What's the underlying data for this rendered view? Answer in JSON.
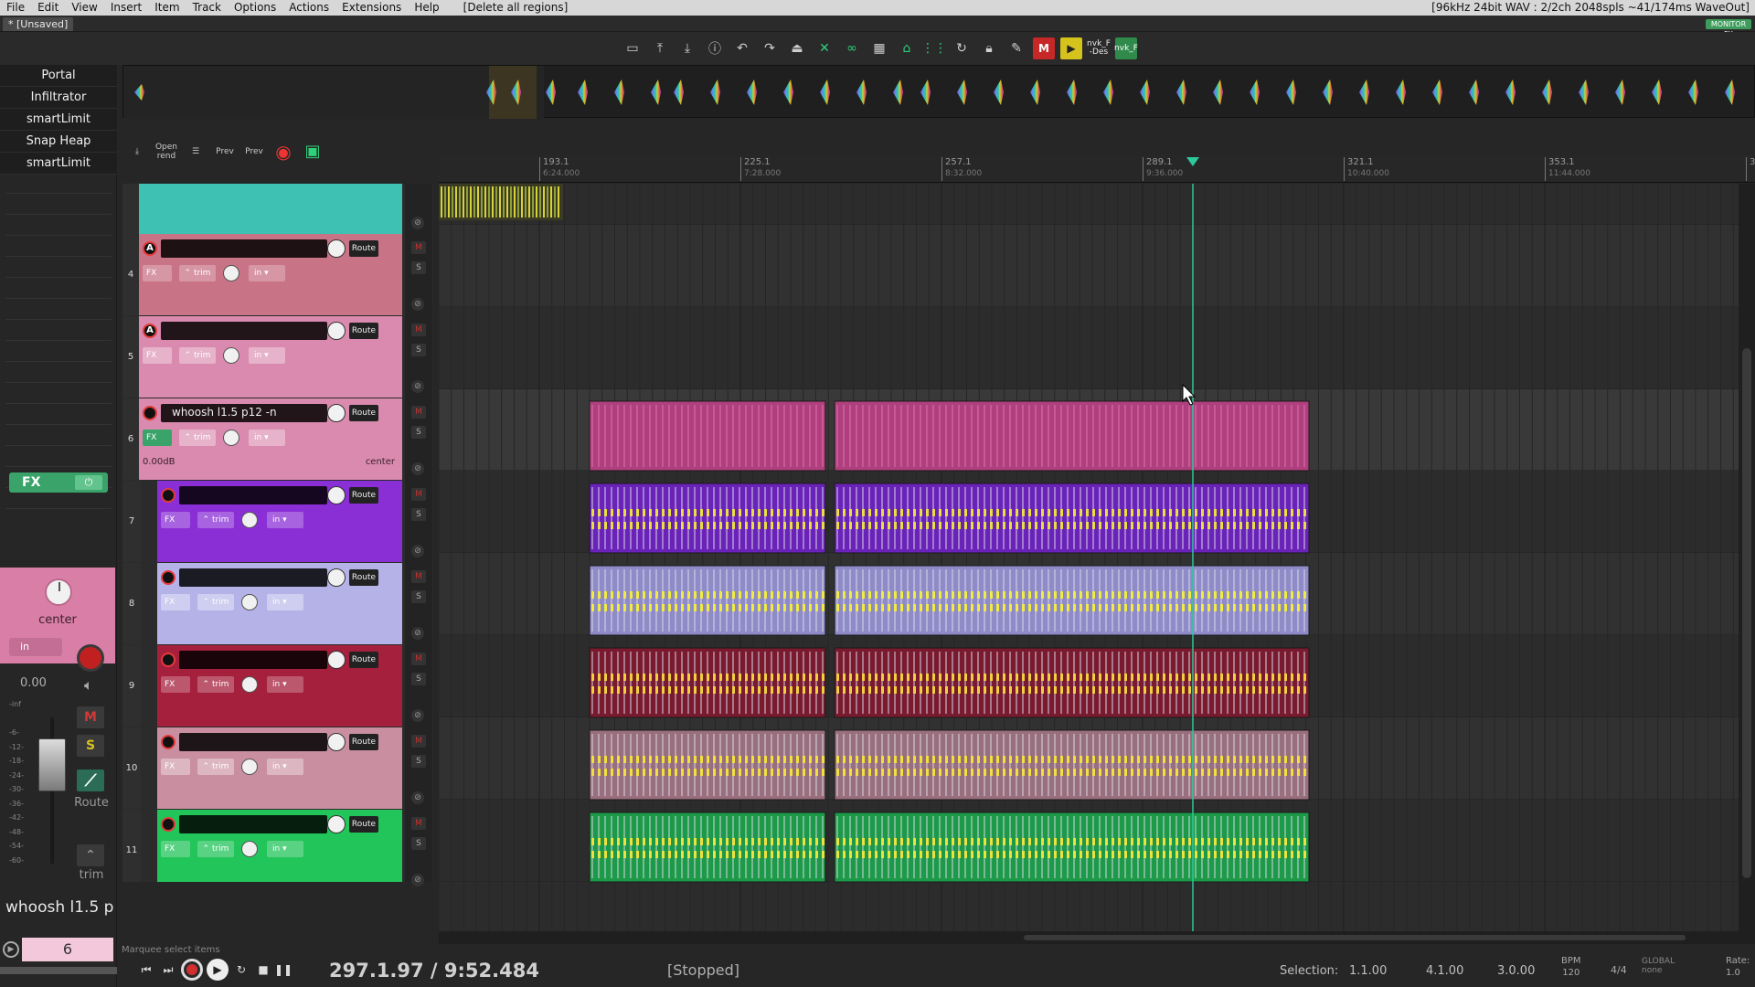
{
  "menu": {
    "items": [
      "File",
      "Edit",
      "View",
      "Insert",
      "Item",
      "Track",
      "Options",
      "Actions",
      "Extensions",
      "Help"
    ],
    "region_action": "[Delete all regions]",
    "status": "[96kHz 24bit WAV : 2/2ch 2048spls ~41/174ms WaveOut]"
  },
  "tab": {
    "label": "* [Unsaved]",
    "monitor_fx": "MONITOR FX"
  },
  "toolbar": {
    "icons": [
      "new-project-icon",
      "save-icon",
      "render-icon",
      "info-icon",
      "undo-icon",
      "redo-icon",
      "metronome-icon",
      "ripple-icon",
      "link-icon",
      "grid-icon",
      "snap-icon",
      "grid-lines-icon",
      "loop-icon",
      "lock-icon",
      "draw-icon"
    ],
    "m_label": "M",
    "nvk1": "nvk_F\n-Des",
    "nvk2": "nvk_F"
  },
  "fx_list": [
    "Portal",
    "Infiltrator",
    "smartLimit",
    "Snap Heap",
    "smartLimit"
  ],
  "track_toolbar": {
    "open_label": "Open\nrend",
    "prev1": "Prev",
    "prev2": "Prev"
  },
  "ruler": {
    "marks": [
      {
        "bar": "193.1",
        "time": "6:24.000"
      },
      {
        "bar": "225.1",
        "time": "7:28.000"
      },
      {
        "bar": "257.1",
        "time": "8:32.000"
      },
      {
        "bar": "289.1",
        "time": "9:36.000"
      },
      {
        "bar": "321.1",
        "time": "10:40.000"
      },
      {
        "bar": "353.1",
        "time": "11:44.000"
      }
    ],
    "edge": "3"
  },
  "tracks": [
    {
      "num": "",
      "color": "#3ec1b3",
      "name": "",
      "partial": true
    },
    {
      "num": "4",
      "color": "#c97386",
      "name": "",
      "icon": "A"
    },
    {
      "num": "5",
      "color": "#d98aae",
      "name": "",
      "icon": "A"
    },
    {
      "num": "6",
      "color": "#d98aae",
      "name": "whoosh l1.5 p12 -n",
      "icon": "O",
      "vol": "0.00dB",
      "pan": "center",
      "folder": true
    },
    {
      "num": "7",
      "color": "#8a2fd6",
      "name": "",
      "icon": "O",
      "child": true
    },
    {
      "num": "8",
      "color": "#b5b2e8",
      "name": "",
      "icon": "O",
      "child": true
    },
    {
      "num": "9",
      "color": "#a4203c",
      "name": "",
      "icon": "O",
      "child": true
    },
    {
      "num": "10",
      "color": "#c98fa0",
      "name": "",
      "icon": "O",
      "child": true
    },
    {
      "num": "11",
      "color": "#22c55a",
      "name": "",
      "icon": "O",
      "child": true
    }
  ],
  "track_labels": {
    "route": "Route",
    "fx": "FX",
    "trim": "trim",
    "in": "in"
  },
  "mixer": {
    "fx_label": "FX",
    "pan": "center",
    "in": "in",
    "volume": "0.00",
    "meter": [
      "-inf",
      "",
      "-6-",
      "-12-",
      "-18-",
      "-24-",
      "-30-",
      "-36-",
      "-42-",
      "-48-",
      "-54-",
      "-60-"
    ],
    "m": "M",
    "s": "S",
    "route": "Route",
    "trim": "trim",
    "track_name": "whoosh l1.5 p",
    "track_num": "6"
  },
  "transport": {
    "hint": "Marquee select items",
    "position": "297.1.97 / 9:52.484",
    "state": "[Stopped]",
    "selection_label": "Selection:",
    "sel_start": "1.1.00",
    "sel_end": "4.1.00",
    "sel_len": "3.0.00",
    "bpm_label": "BPM",
    "bpm": "120",
    "signature": "4/4",
    "global": "GLOBAL",
    "none": "none",
    "rate_label": "Rate:",
    "rate": "1.0"
  },
  "colors": {
    "track_pink": "#d98aae",
    "playhead": "#2dc89b",
    "record": "#d32f2f"
  }
}
